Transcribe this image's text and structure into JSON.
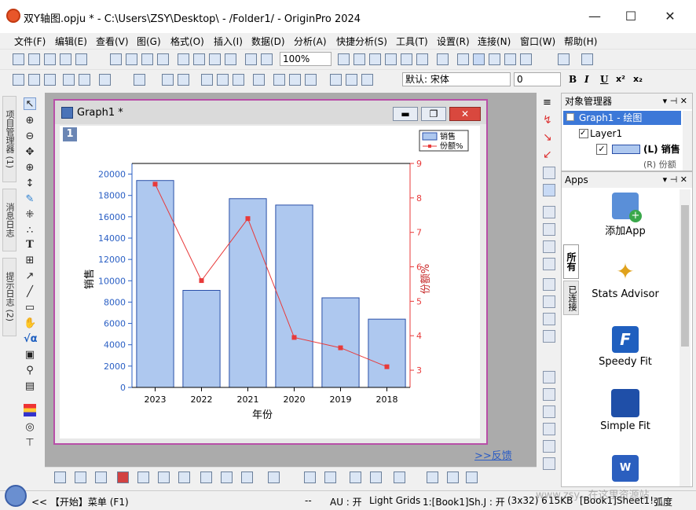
{
  "window": {
    "title": "双Y轴图.opju * - C:\\Users\\ZSY\\Desktop\\ - /Folder1/ - OriginPro 2024",
    "min": "—",
    "max": "☐",
    "close": "✕"
  },
  "menu": [
    "文件(F)",
    "编辑(E)",
    "查看(V)",
    "图(G)",
    "格式(O)",
    "插入(I)",
    "数据(D)",
    "分析(A)",
    "快捷分析(S)",
    "工具(T)",
    "设置(R)",
    "连接(N)",
    "窗口(W)",
    "帮助(H)"
  ],
  "toolbar": {
    "zoom": "100%",
    "font": "默认: 宋体",
    "font_size": "0",
    "bold": "B",
    "italic": "I",
    "underline": "U",
    "superscript": "x²",
    "subscript": "x₂"
  },
  "left_tabs": [
    "项目管理器 (1)",
    "消息日志",
    "提示日志 (2)"
  ],
  "graph_window": {
    "title": "Graph1 *",
    "layer_badge": "1"
  },
  "chart_data": {
    "type": "bar",
    "categories": [
      "2023",
      "2022",
      "2021",
      "2020",
      "2019",
      "2018"
    ],
    "series": [
      {
        "name": "销售",
        "type": "bar",
        "values": [
          19400,
          9100,
          17700,
          17100,
          8400,
          6400
        ],
        "axis": "left",
        "color": "#aec8ef",
        "stroke": "#2a4fa8"
      },
      {
        "name": "份额%",
        "type": "line",
        "values": [
          8.4,
          5.6,
          7.4,
          3.95,
          3.65,
          3.1
        ],
        "axis": "right",
        "color": "#e83a3a"
      }
    ],
    "xlabel": "年份",
    "ylabel": "销售",
    "y2label": "份额%",
    "ylim": [
      0,
      21000
    ],
    "y2lim": [
      2.5,
      9
    ],
    "yticks": [
      0,
      2000,
      4000,
      6000,
      8000,
      10000,
      12000,
      14000,
      16000,
      18000,
      20000
    ],
    "y2ticks": [
      3,
      4,
      5,
      6,
      7,
      8,
      9
    ],
    "legend": "top-right",
    "left_axis_color": "#2a5fc4",
    "right_axis_color": "#e83a3a"
  },
  "feedback_link": ">>反馈",
  "object_manager": {
    "title": "对象管理器",
    "root": "Graph1 - 绘图",
    "layer": "Layer1",
    "item1": "(L) 销售",
    "item2": "(R) 份额"
  },
  "apps": {
    "title": "Apps",
    "tab_all": "所有",
    "tab_installed": "已连接",
    "items": [
      "添加App",
      "Stats Advisor",
      "Speedy Fit",
      "Simple Fit"
    ]
  },
  "status": {
    "start": "<< 【开始】菜单 (F1)",
    "dash": "--",
    "au": "AU : 开",
    "grid": "Light Grids",
    "book": "1:[Book1]Sh.J : 开",
    "size": "(3x32) 6",
    "kb": "15KB",
    "sheet": "[Book1]Sheet1!",
    "angle": "弧度",
    "watermark": "www.zsy...在这里资源站"
  }
}
